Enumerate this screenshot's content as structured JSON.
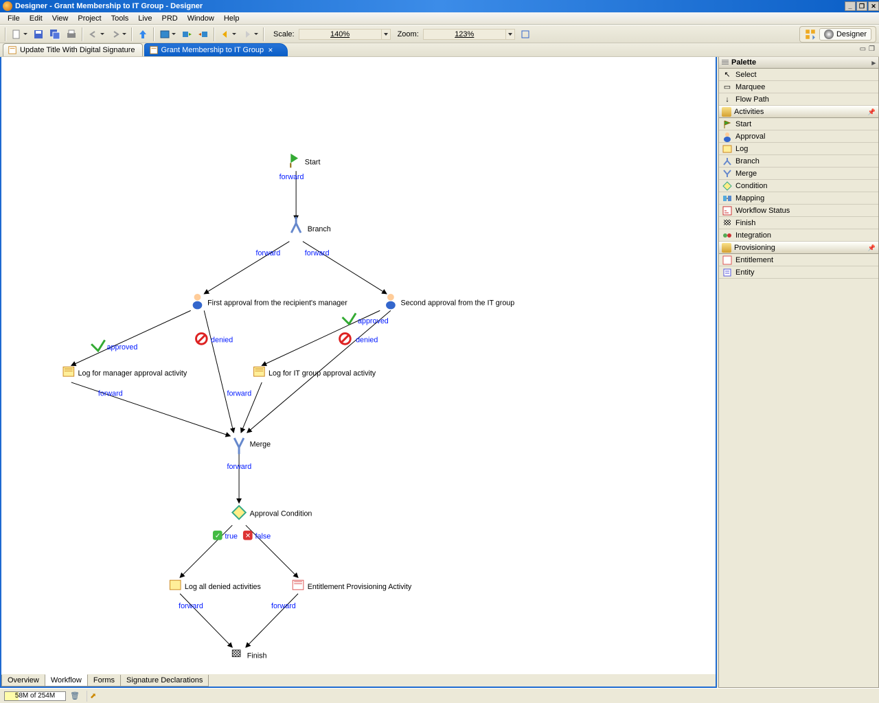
{
  "window": {
    "title": "Designer - Grant Membership to IT Group - Designer"
  },
  "menus": [
    "File",
    "Edit",
    "View",
    "Project",
    "Tools",
    "Live",
    "PRD",
    "Window",
    "Help"
  ],
  "toolbar": {
    "scale_label": "Scale:",
    "scale_value": "140%",
    "zoom_label": "Zoom:",
    "zoom_value": "123%",
    "perspective": "Designer"
  },
  "tabs": {
    "inactive": "Update Title With Digital Signature",
    "active": "Grant Membership to IT Group"
  },
  "bottom_tabs": [
    "Overview",
    "Workflow",
    "Forms",
    "Signature Declarations"
  ],
  "palette": {
    "title": "Palette",
    "tools": [
      "Select",
      "Marquee",
      "Flow Path"
    ],
    "activities_label": "Activities",
    "activities": [
      "Start",
      "Approval",
      "Log",
      "Branch",
      "Merge",
      "Condition",
      "Mapping",
      "Workflow Status",
      "Finish",
      "Integration"
    ],
    "provisioning_label": "Provisioning",
    "provisioning": [
      "Entitlement",
      "Entity"
    ]
  },
  "status": {
    "memory": "58M of 254M"
  },
  "workflow": {
    "start": "Start",
    "branch": "Branch",
    "approval1": "First approval from the recipient's manager",
    "approval2": "Second approval from the IT group",
    "log1": "Log for manager approval activity",
    "log2": "Log for IT group approval activity",
    "merge": "Merge",
    "cond": "Approval Condition",
    "log3": "Log all denied activities",
    "entitle": "Entitlement Provisioning Activity",
    "finish": "Finish",
    "forward": "forward",
    "approved": "approved",
    "denied": "denied",
    "true": "true",
    "false": "false"
  }
}
